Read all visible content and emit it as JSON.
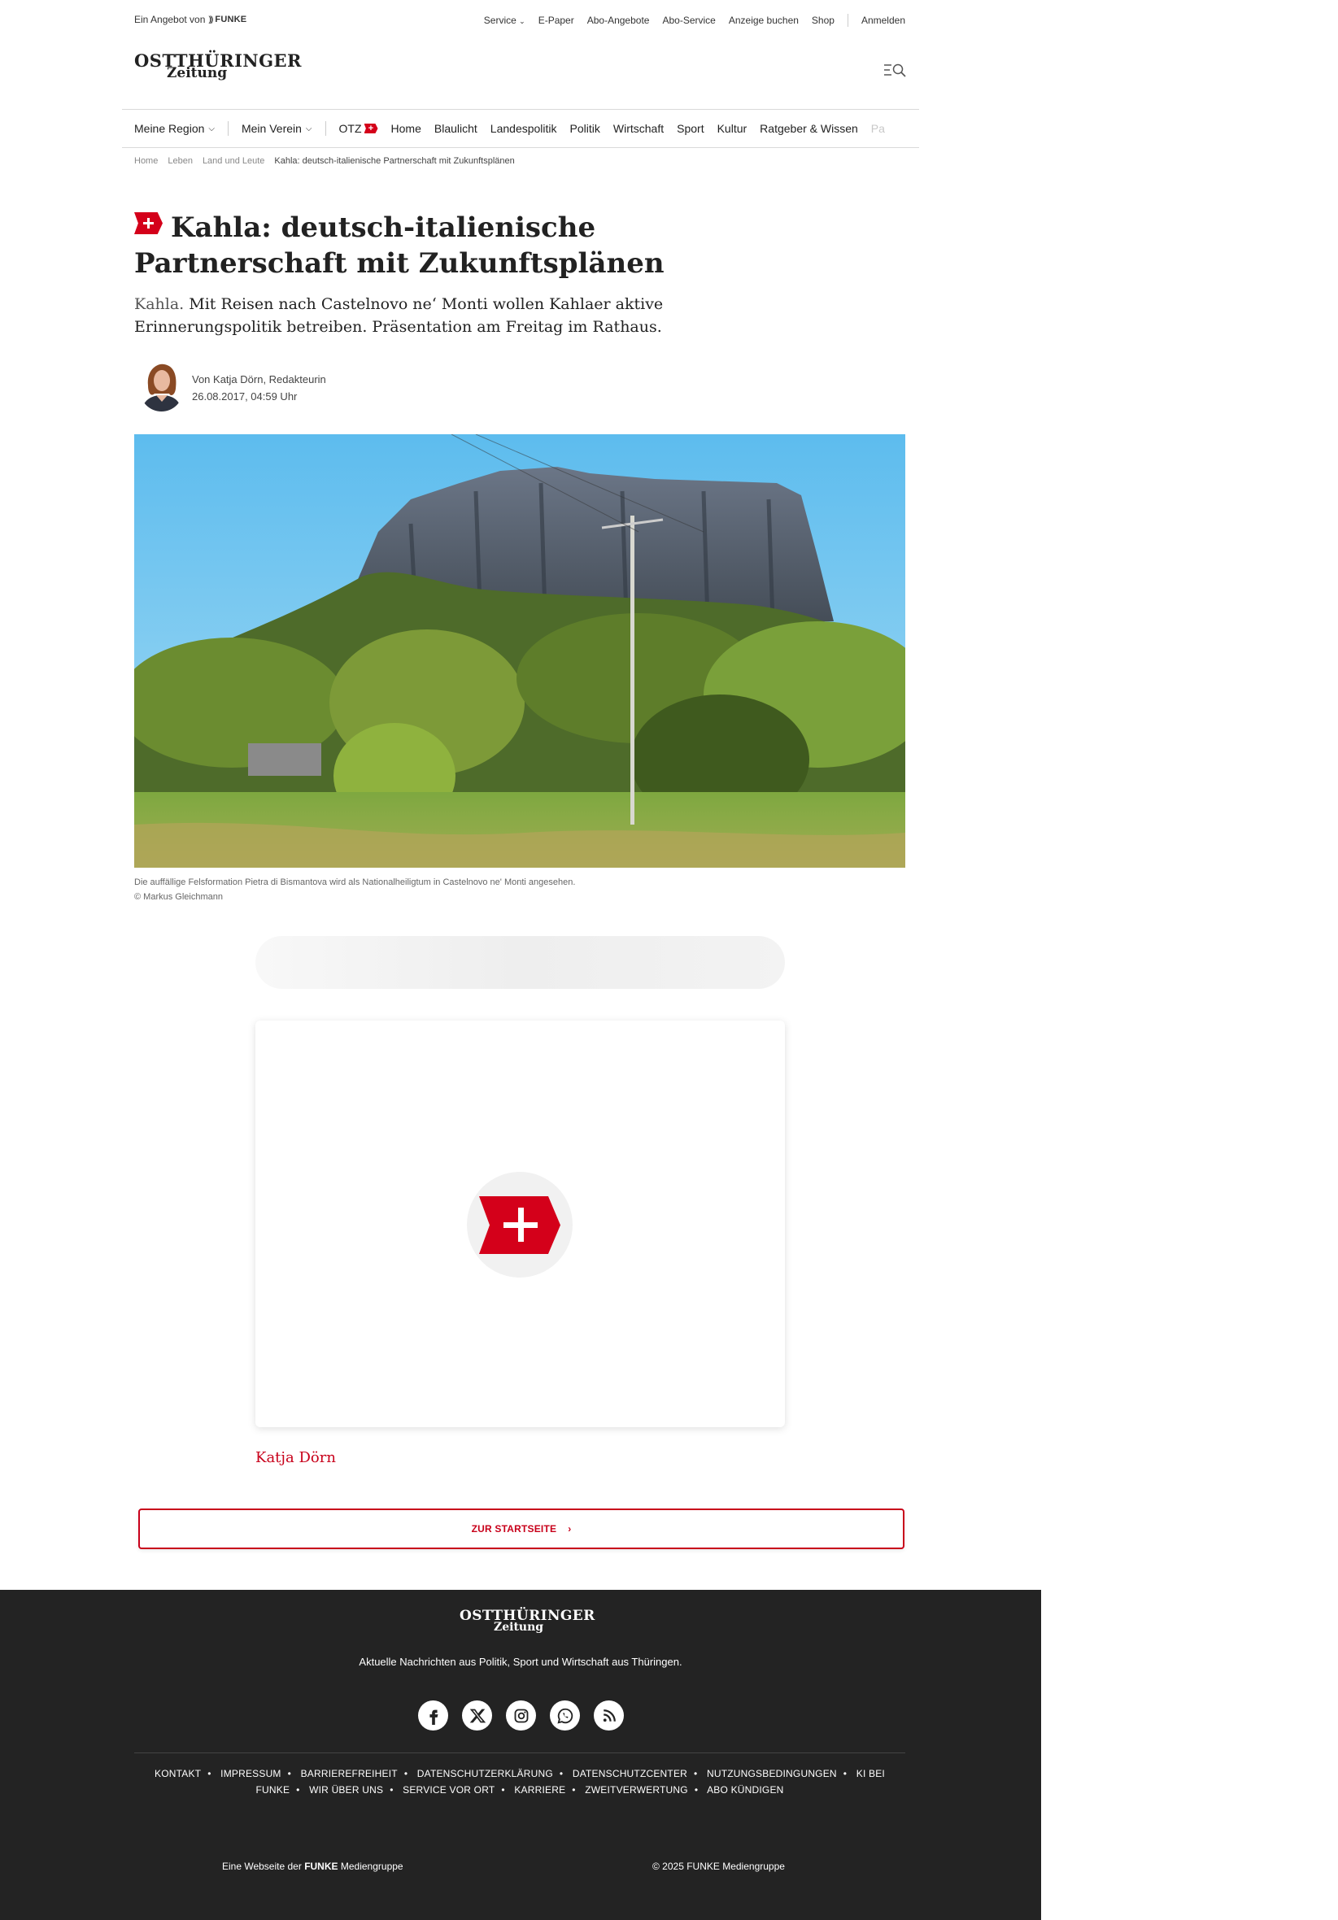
{
  "topbar": {
    "offer_prefix": "Ein Angebot von",
    "offer_brand": "FUNKE",
    "links": [
      "Service",
      "E-Paper",
      "Abo-Angebote",
      "Abo-Service",
      "Anzeige buchen",
      "Shop"
    ],
    "login": "Anmelden"
  },
  "header": {
    "logo_line1": "OSTTHÜRINGER",
    "logo_line2": "Zeitung",
    "menu_icon": "menu-search-icon"
  },
  "nav": {
    "region": "Meine Region",
    "verein": "Mein Verein",
    "otz": "OTZ",
    "items": [
      "Home",
      "Blaulicht",
      "Landespolitik",
      "Politik",
      "Wirtschaft",
      "Sport",
      "Kultur",
      "Ratgeber & Wissen"
    ],
    "faded": "Pa"
  },
  "breadcrumb": [
    "Home",
    "Leben",
    "Land und Leute",
    "Kahla: deutsch-italienische Partnerschaft mit Zukunftsplänen"
  ],
  "article": {
    "headline": "Kahla: deutsch-italienische Partnerschaft mit Zukunftsplänen",
    "location": "Kahla.",
    "teaser": "Mit Reisen nach Castelnovo ne‘ Monti wollen Kahlaer aktive Erinnerungspolitik betreiben. Präsentation am Freitag im Rathaus.",
    "author_line": "Von Katja Dörn, Redakteurin",
    "date": "26.08.2017, 04:59 Uhr",
    "image_caption": "Die auffällige Felsformation Pietra di Bismantova wird als Nationalheiligtum in Castelnovo ne' Monti angesehen.",
    "image_credit": "© Markus Gleichmann",
    "author_link": "Katja Dörn",
    "start_button": "ZUR STARTSEITE"
  },
  "footer": {
    "logo_line1": "OSTTHÜRINGER",
    "logo_line2": "Zeitung",
    "tagline": "Aktuelle Nachrichten aus Politik, Sport und Wirtschaft aus Thüringen.",
    "social": [
      "facebook-icon",
      "x-icon",
      "instagram-icon",
      "whatsapp-icon",
      "rss-icon"
    ],
    "links": [
      "KONTAKT",
      "IMPRESSUM",
      "BARRIEREFREIHEIT",
      "DATENSCHUTZERKLÄRUNG",
      "DATENSCHUTZCENTER",
      "NUTZUNGSBEDINGUNGEN",
      "KI BEI FUNKE",
      "WIR ÜBER UNS",
      "SERVICE VOR ORT",
      "KARRIERE",
      "ZWEITVERWERTUNG",
      "ABO KÜNDIGEN"
    ],
    "bottom_left_prefix": "Eine Webseite der",
    "bottom_left_brand": "FUNKE",
    "bottom_left_suffix": "Mediengruppe",
    "copyright": "© 2025 FUNKE Mediengruppe"
  },
  "colors": {
    "accent": "#d4001a",
    "footer_bg": "#232323"
  }
}
